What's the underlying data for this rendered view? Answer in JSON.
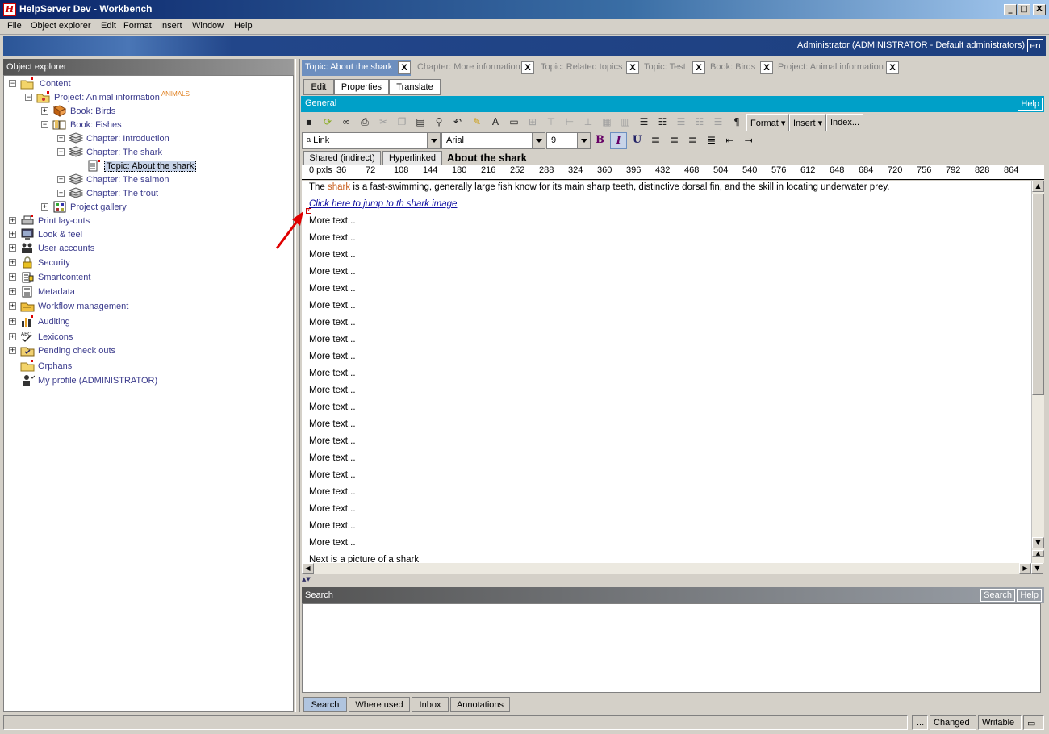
{
  "window": {
    "title": "HelpServer Dev - Workbench",
    "minimize": "_",
    "maximize": "□",
    "close": "X"
  },
  "menu": [
    "File",
    "Object explorer",
    "Edit",
    "Format",
    "Insert",
    "Window",
    "Help"
  ],
  "banner": {
    "user": "Administrator (ADMINISTRATOR - Default administrators)",
    "lang": "en"
  },
  "explorer": {
    "header": "Object explorer",
    "animals_tag": "ANIMALS",
    "nodes": [
      "Content",
      "Project: Animal information",
      "Book: Birds",
      "Book: Fishes",
      "Chapter: Introduction",
      "Chapter: The shark",
      "Topic: About the shark",
      "Chapter: The salmon",
      "Chapter: The trout",
      "Project gallery",
      "Print lay-outs",
      "Look & feel",
      "User accounts",
      "Security",
      "Smartcontent",
      "Metadata",
      "Workflow management",
      "Auditing",
      "Lexicons",
      "Pending check outs",
      "Orphans",
      "My profile (ADMINISTRATOR)"
    ]
  },
  "doc_tabs": [
    "Topic: About the shark",
    "Chapter: More information",
    "Topic: Related topics",
    "Topic: Test",
    "Book: Birds",
    "Project: Animal information"
  ],
  "doc_tab_close": "X",
  "mode_tabs": [
    "Edit",
    "Properties",
    "Translate"
  ],
  "general": {
    "label": "General",
    "help": "Help"
  },
  "toolbar": {
    "format": "Format",
    "insert": "Insert",
    "index": "Index..."
  },
  "format_bar": {
    "style": "Link",
    "font": "Arial",
    "size": "9",
    "bold": "B",
    "italic": "I",
    "underline": "U"
  },
  "subtabs": [
    "Shared (indirect)",
    "Hyperlinked"
  ],
  "doc_title": "About the shark",
  "ruler": [
    "0 pxls",
    "36",
    "72",
    "108",
    "144",
    "180",
    "216",
    "252",
    "288",
    "324",
    "360",
    "396",
    "432",
    "468",
    "504",
    "540",
    "576",
    "612",
    "648",
    "684",
    "720",
    "756",
    "792",
    "828",
    "864"
  ],
  "editor": {
    "intro_before": "The ",
    "intro_shark": "shark",
    "intro_after": " is a fast-swimming, generally large fish know for its main sharp teeth, distinctive dorsal fin, and the skill in locating underwater prey.",
    "link": "Click here to jump to th shark image",
    "more": "More text...",
    "last": "Next is a picture of a shark"
  },
  "search": {
    "header": "Search",
    "search_btn": "Search",
    "help_btn": "Help"
  },
  "bottom_tabs": [
    "Search",
    "Where used",
    "Inbox",
    "Annotations"
  ],
  "status": {
    "dots": "...",
    "changed": "Changed",
    "writable": "Writable"
  }
}
